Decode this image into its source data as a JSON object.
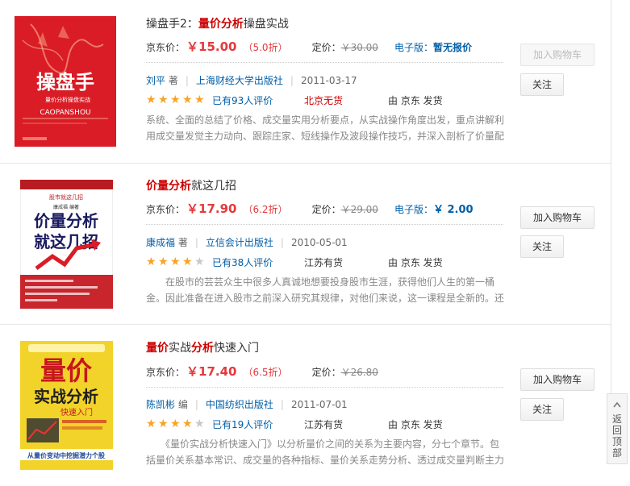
{
  "books": [
    {
      "title_parts": [
        {
          "text": "操盘手2：",
          "hl": false
        },
        {
          "text": "量价分析",
          "hl": true
        },
        {
          "text": "操盘实战",
          "hl": false
        }
      ],
      "price_label": "京东价：",
      "price": "￥15.00",
      "discount": "（5.0折）",
      "orig_label": "定价：",
      "orig_price": "￥30.00",
      "ebook_label": "电子版：",
      "ebook_value": "暂无报价",
      "author": "刘平",
      "author_role": " 著",
      "publisher": "上海财经大学出版社",
      "date": "2011-03-17",
      "rating": 5,
      "reviews": "已有93人评价",
      "stock": "北京无货",
      "stock_red": true,
      "seller": "由 京东 发货",
      "desc": "系统、全面的总结了价格、成交量实用分析要点，从实战操作角度出发，重点讲解利用成交量发觉主力动向、跟踪庄家、短线操作及波段操作技巧，并深入剖析了价量配合的关系。",
      "cart_label": "加入购物车",
      "cart_disabled": true,
      "follow_label": "关注",
      "cover": {
        "big": "操盘手",
        "sub": "量价分析操盘实战",
        "en": "CAOPANSHOU",
        "bg": "#e2202b"
      }
    },
    {
      "title_parts": [
        {
          "text": "价量分析",
          "hl": true
        },
        {
          "text": "就这几招",
          "hl": false
        }
      ],
      "price_label": "京东价：",
      "price": "￥17.90",
      "discount": "（6.2折）",
      "orig_label": "定价：",
      "orig_price": "￥29.00",
      "ebook_label": "电子版：",
      "ebook_value": "￥ 2.00",
      "author": "康成福",
      "author_role": " 著",
      "publisher": "立信会计出版社",
      "date": "2010-05-01",
      "rating": 4,
      "reviews": "已有38人评价",
      "stock": "江苏有货",
      "stock_red": false,
      "seller": "由 京东 发货",
      "desc": "　　在股市的芸芸众生中很多人真诚地想要投身股市生涯，获得他们人生的第一桶金。因此准备在进入股市之前深入研究其规律，对他们来说，这一课程是全新的。还有许多人已",
      "cart_label": "加入购物车",
      "cart_disabled": false,
      "follow_label": "关注",
      "cover": {
        "big": "价量分析就这几招",
        "top": "股市就这几招",
        "author": "康成福 编著",
        "bg": "#ffffff"
      }
    },
    {
      "title_parts": [
        {
          "text": "量价",
          "hl": true
        },
        {
          "text": "实战",
          "hl": false
        },
        {
          "text": "分析",
          "hl": true
        },
        {
          "text": "快速入门",
          "hl": false
        }
      ],
      "price_label": "京东价：",
      "price": "￥17.40",
      "discount": "（6.5折）",
      "orig_label": "定价：",
      "orig_price": "￥26.80",
      "ebook_label": "",
      "ebook_value": "",
      "author": "陈凯彬",
      "author_role": " 编",
      "publisher": "中国纺织出版社",
      "date": "2011-07-01",
      "rating": 4,
      "reviews": "已有19人评价",
      "stock": "江苏有货",
      "stock_red": false,
      "seller": "由 京东 发货",
      "desc": "　　《量价实战分析快速入门》以分析量价之间的关系为主要内容，分七个章节。包括量价关系基本常识、成交量的各种指标、量价关系走势分析、透过成交量判断主力意图等内容。",
      "cart_label": "加入购物车",
      "cart_disabled": false,
      "follow_label": "关注",
      "cover": {
        "big1": "量价",
        "big2": "实战分析",
        "sub": "快速入门",
        "bottom": "从量价变动中挖掘潜力个股",
        "bg": "#f2d32a"
      }
    }
  ],
  "back_to_top": {
    "line1": "返",
    "line2": "回",
    "line3": "顶",
    "line4": "部"
  },
  "colors": {
    "price": "#e4393c",
    "link": "#005ea7",
    "star": "#f8a321"
  }
}
